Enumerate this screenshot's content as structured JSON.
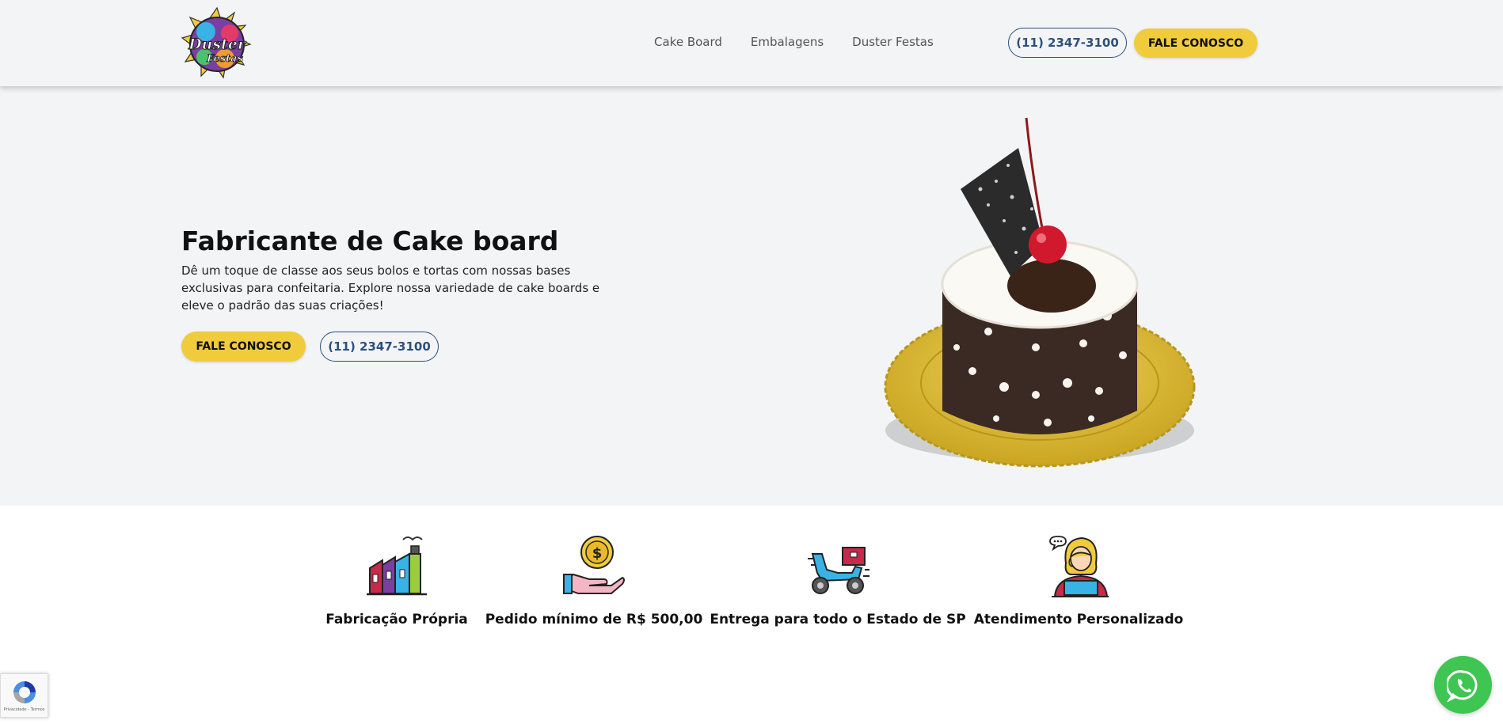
{
  "brand": {
    "logo_text_top": "Duster",
    "logo_text_bottom": "Festas"
  },
  "nav": {
    "items": [
      {
        "label": "Cake Board"
      },
      {
        "label": "Embalagens"
      },
      {
        "label": "Duster Festas"
      }
    ]
  },
  "header": {
    "phone": "(11) 2347-3100",
    "cta": "FALE CONOSCO"
  },
  "hero": {
    "title": "Fabricante de Cake board",
    "description": "Dê um toque de classe aos seus bolos e tortas com nossas bases exclusivas para confeitaria. Explore nossa variedade de cake boards e eleve o padrão das suas criações!",
    "cta": "FALE CONOSCO",
    "phone": "(11) 2347-3100",
    "image_icon": "cake-image"
  },
  "features": [
    {
      "icon": "factory-icon",
      "label": "Fabricação Própria"
    },
    {
      "icon": "coin-hand-icon",
      "label": "Pedido mínimo de R$ 500,00"
    },
    {
      "icon": "delivery-scooter-icon",
      "label": "Entrega para todo o Estado de SP"
    },
    {
      "icon": "support-agent-icon",
      "label": "Atendimento Personalizado"
    }
  ],
  "recaptcha": {
    "text": "Privacidade - Termos"
  },
  "colors": {
    "accent_yellow": "#f0cc3c",
    "navy": "#2d4f7d",
    "whatsapp_green": "#3fc551",
    "hero_bg": "#f3f4f6"
  }
}
